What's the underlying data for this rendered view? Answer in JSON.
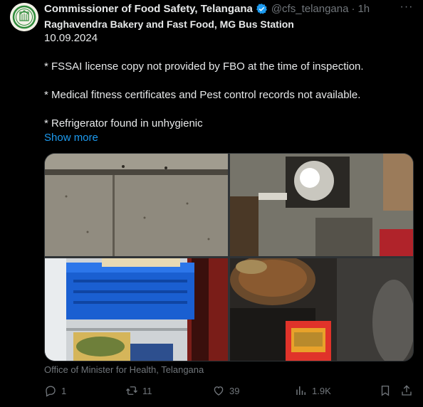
{
  "tweet": {
    "author_name": "Commissioner of Food Safety, Telangana",
    "handle": "@cfs_telangana",
    "separator": "·",
    "time": "1h",
    "more_label": "···",
    "lines": [
      "Raghavendra Bakery and Fast Food, MG Bus Station",
      "10.09.2024",
      "* FSSAI license copy not provided by FBO at the time of inspection.",
      "* Medical fitness certificates and Pest control records not available.",
      "* Refrigerator found in unhygienic"
    ],
    "show_more": "Show more",
    "media_caption": "Office of Minister for Health, Telangana",
    "accent": "#1d9bf0",
    "stats": {
      "replies": "1",
      "reposts": "11",
      "likes": "39",
      "views": "1.9K"
    }
  },
  "icons": {
    "reply": "reply-icon",
    "repost": "repost-icon",
    "like": "heart-icon",
    "views": "views-icon",
    "bookmark": "bookmark-icon",
    "share": "share-icon",
    "verified": "verified-badge-icon",
    "more": "more-icon"
  },
  "media": [
    {
      "name": "photo-wall-ceiling"
    },
    {
      "name": "photo-exhaust-fan"
    },
    {
      "name": "photo-refrigerator-crate"
    },
    {
      "name": "photo-cooking-pans"
    }
  ]
}
